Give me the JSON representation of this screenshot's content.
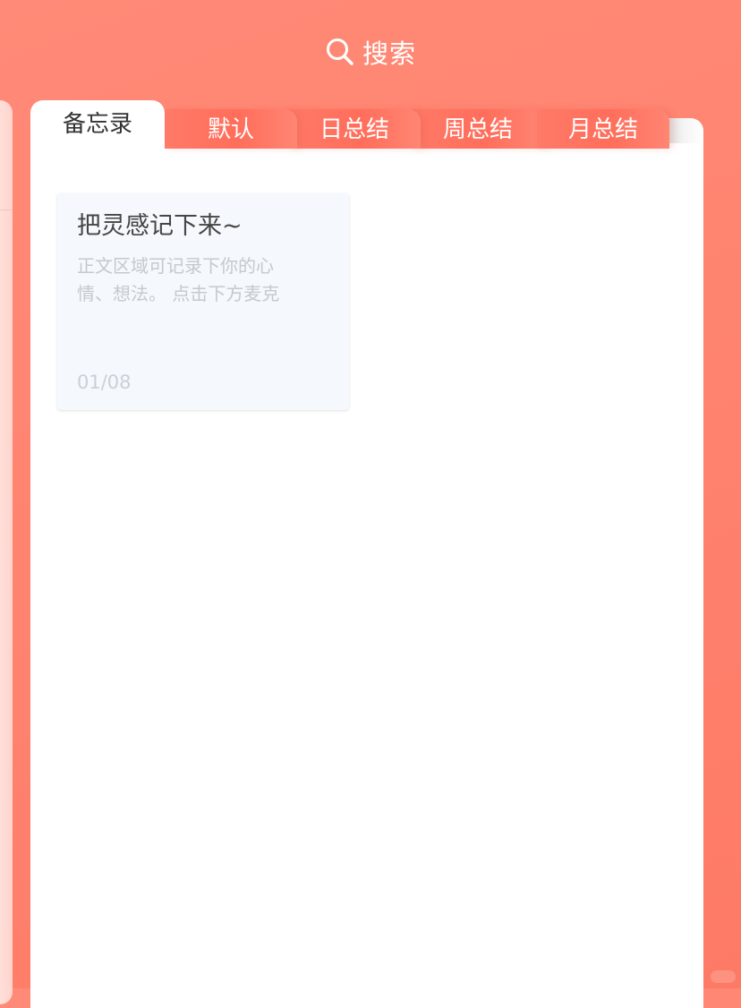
{
  "search": {
    "icon": "search-icon",
    "label": "搜索"
  },
  "tabs": [
    {
      "label": "备忘录",
      "active": true
    },
    {
      "label": "默认",
      "active": false
    },
    {
      "label": "日总结",
      "active": false
    },
    {
      "label": "周总结",
      "active": false
    },
    {
      "label": "月总结",
      "active": false
    }
  ],
  "note": {
    "title": "把灵感记下来~",
    "body_lines": [
      "正文区域可记录下你的心",
      "情、想法。  点击下方麦克"
    ],
    "date": "01/08"
  },
  "colors": {
    "background_top": "#ff8a77",
    "background_bottom": "#fd7a66",
    "active_tab": "#ffffff",
    "inactive_tab": "#ff6e5b",
    "card": "#ffffff",
    "note_background": "#f5f8fc"
  }
}
